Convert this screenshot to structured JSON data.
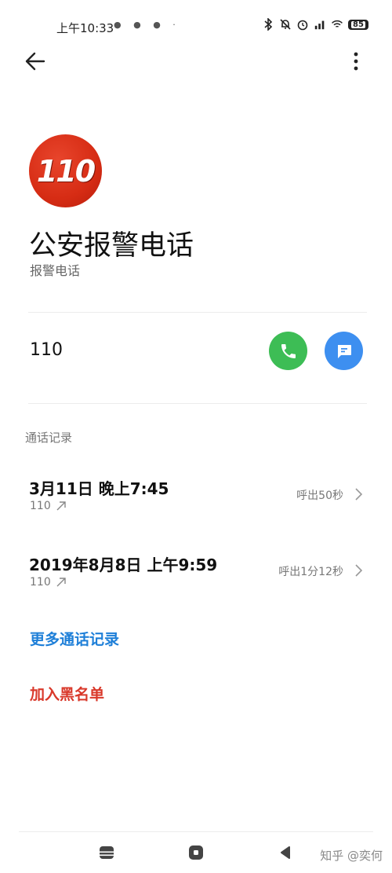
{
  "status_bar": {
    "time": "上午10:33",
    "app_icons": "● ● ● ·",
    "battery": "85"
  },
  "contact": {
    "avatar_text": "110",
    "name": "公安报警电话",
    "subtitle": "报警电话",
    "number": "110"
  },
  "call_log": {
    "section_title": "通话记录",
    "entries": [
      {
        "date": "3月11日 晚上7:45",
        "number": "110",
        "duration": "呼出50秒"
      },
      {
        "date": "2019年8月8日 上午9:59",
        "number": "110",
        "duration": "呼出1分12秒"
      }
    ],
    "more_label": "更多通话记录"
  },
  "actions": {
    "block_label": "加入黑名单"
  },
  "watermark": "知乎 @奕何",
  "colors": {
    "call_green": "#3dbd55",
    "message_blue": "#3d8ff0",
    "link_blue": "#1e7fd8",
    "danger_red": "#d9382a",
    "avatar_red": "#d62c14"
  },
  "icons": {
    "back": "arrow-left-icon",
    "more": "more-vertical-icon",
    "call": "phone-icon",
    "message": "chat-bubble-icon",
    "outgoing": "outgoing-arrow-icon",
    "chevron": "chevron-right-icon"
  }
}
